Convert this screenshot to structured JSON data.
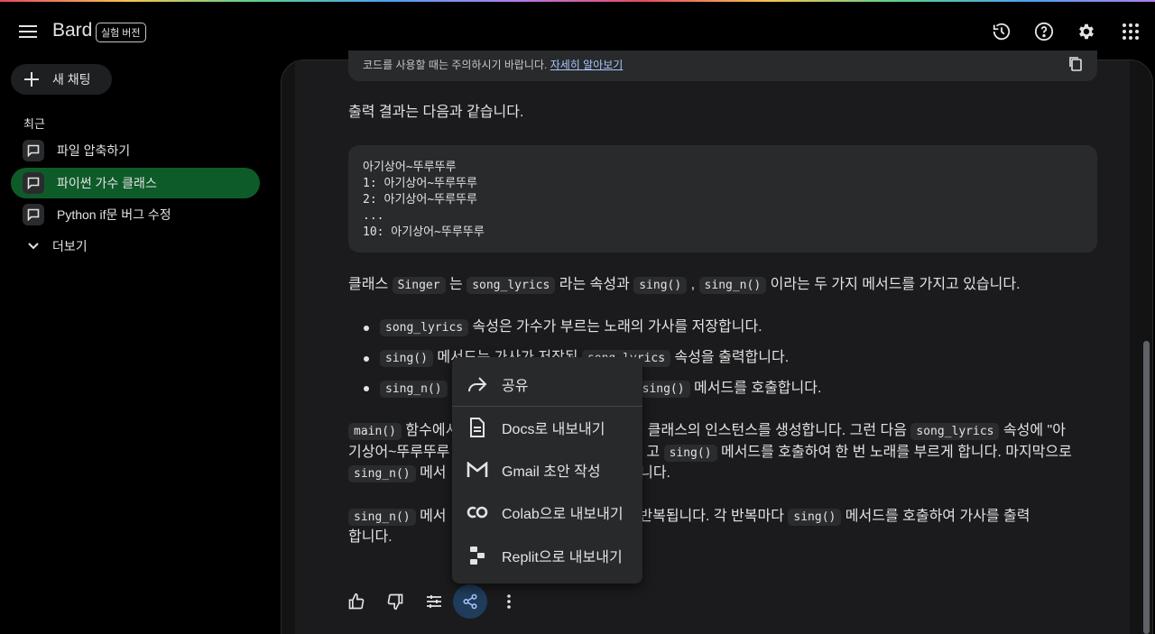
{
  "app": {
    "name": "Bard",
    "badge": "실험 버전"
  },
  "sidebar": {
    "new_chat": "새 채팅",
    "recent_label": "최근",
    "items": [
      {
        "label": "파일 압축하기",
        "active": false
      },
      {
        "label": "파이썬 가수 클래스",
        "active": true
      },
      {
        "label": "Python if문 버그 수정",
        "active": false
      }
    ],
    "more_label": "더보기"
  },
  "content": {
    "code_warning": "코드를 사용할 때는 주의하시기 바랍니다.",
    "code_warning_link": "자세히 알아보기",
    "output_intro": "출력 결과는 다음과 같습니다.",
    "output_lines": [
      "아기상어~뚜루뚜루",
      "1: 아기상어~뚜루뚜루",
      "2: 아기상어~뚜루뚜루",
      "...",
      "10: 아기상어~뚜루뚜루"
    ],
    "class_para": {
      "t1": "클래스 ",
      "c1": "Singer",
      "t2": " 는 ",
      "c2": "song_lyrics",
      "t3": " 라는 속성과 ",
      "c3": "sing()",
      "t4": " , ",
      "c4": "sing_n()",
      "t5": " 이라는 두 가지 메서드를 가지고 있습니다."
    },
    "bullets": [
      {
        "code": "song_lyrics",
        "text": " 속성은 가수가 부르는 노래의 가사를 저장합니다."
      },
      {
        "code": "sing()",
        "text_left": " 메서드는 가사가 저장된 ",
        "code2": "song_lyrics",
        "text": " 속성을 출력합니다."
      },
      {
        "code": "sing_n()",
        "code2": "sing()",
        "text": " 메서드를 호출합니다."
      }
    ],
    "main_para": {
      "c1": "main()",
      "t1": " 함수에서 ",
      "t2": "클래스의 인스턴스를 생성합니다. 그런 다음 ",
      "c2": "song_lyrics",
      "t3": " 속성에 \"아",
      "line2a": "기상어~뚜루뚜루",
      "line2b": "고 ",
      "c3": "sing()",
      "line2c": " 메서드를 호출하여 한 번 노래를 부르게 합니다. 마지막으로",
      "c4": "sing_n()",
      "line3a": " 메서",
      "line3b": "르게 합니다."
    },
    "last_para": {
      "c1": "sing_n()",
      "t1": " 메서",
      "t2": "만큼 반복됩니다. 각 반복마다 ",
      "c2": "sing()",
      "t3": " 메서드를 호출하여 가사를 출력",
      "line2": "합니다."
    }
  },
  "share_menu": {
    "items": [
      {
        "label": "공유",
        "icon": "share-arrow-icon"
      },
      {
        "label": "Docs로 내보내기",
        "icon": "docs-icon"
      },
      {
        "label": "Gmail 초안 작성",
        "icon": "gmail-icon"
      },
      {
        "label": "Colab으로 내보내기",
        "icon": "colab-icon"
      },
      {
        "label": "Replit으로 내보내기",
        "icon": "replit-icon"
      }
    ]
  },
  "colors": {
    "active_chat": "#0e5b2a",
    "link": "#a8c7fa",
    "menu_bg": "#28292a"
  }
}
